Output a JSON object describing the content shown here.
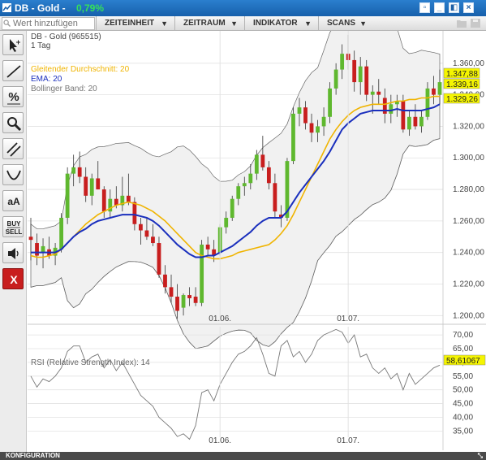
{
  "window": {
    "title": "DB - Gold -",
    "change": "0,79%",
    "change_color": "#35e05a"
  },
  "toolbar": {
    "search_placeholder": "Wert hinzufügen",
    "menus": [
      {
        "label": "ZEITEINHEIT"
      },
      {
        "label": "ZEITRAUM"
      },
      {
        "label": "INDIKATOR"
      },
      {
        "label": "SCANS"
      }
    ]
  },
  "sidebar": {
    "tools": [
      {
        "name": "pointer-tool",
        "icon": "cursor-icon"
      },
      {
        "name": "line-tool",
        "icon": "line-icon"
      },
      {
        "name": "percent-tool",
        "icon": "percent-icon"
      },
      {
        "name": "zoom-tool",
        "icon": "magnifier-icon"
      },
      {
        "name": "channel-tool",
        "icon": "parallel-lines-icon"
      },
      {
        "name": "arc-tool",
        "icon": "arc-icon"
      },
      {
        "name": "text-tool",
        "icon": "text-icon",
        "label": "aA"
      },
      {
        "name": "buy-sell-tool",
        "icon": "buy-sell-icon",
        "label_top": "BUY",
        "label_bottom": "SELL"
      },
      {
        "name": "sound-tool",
        "icon": "speaker-icon"
      },
      {
        "name": "delete-tool",
        "icon": "delete-icon",
        "label": "X"
      }
    ]
  },
  "chart": {
    "instrument": "DB - Gold (965515)",
    "period": "1 Tag",
    "indicators": [
      {
        "label": "Gleitender Durchschnitt: 20",
        "color": "#f0b400"
      },
      {
        "label": "EMA: 20",
        "color": "#1a2fbd"
      },
      {
        "label": "Bollinger Band: 20",
        "color": "#777777"
      }
    ],
    "rsi_label": "RSI (Relative Strength Index): 14",
    "price_labels": [
      {
        "label": "1.347,88",
        "value": 1347.88
      },
      {
        "label": "1.339,16",
        "value": 1339.16
      },
      {
        "label": "1.329,26",
        "value": 1329.26
      }
    ],
    "rsi_value_label": "58,61067",
    "colors": {
      "up": "#5fb82f",
      "down": "#c81e1e",
      "band": "#f1f1f1",
      "sma": "#f0b400",
      "ema": "#1a2fbd",
      "highlight": "#f5f500"
    }
  },
  "chart_data": [
    {
      "type": "candlestick",
      "title": "DB - Gold (965515)",
      "ylim": [
        1195,
        1380
      ],
      "y_ticks": [
        "1.200,00",
        "1.220,00",
        "1.240,00",
        "1.260,00",
        "1.280,00",
        "1.300,00",
        "1.320,00",
        "1.340,00",
        "1.360,00"
      ],
      "y_tick_values": [
        1200,
        1220,
        1240,
        1260,
        1280,
        1300,
        1320,
        1340,
        1360
      ],
      "x_labels": [
        {
          "label": "01.06.",
          "index": 31
        },
        {
          "label": "01.07.",
          "index": 52
        }
      ],
      "candles": [
        [
          1250,
          1262,
          1235,
          1248
        ],
        [
          1246,
          1252,
          1232,
          1238
        ],
        [
          1240,
          1249,
          1230,
          1244
        ],
        [
          1242,
          1250,
          1236,
          1238
        ],
        [
          1238,
          1246,
          1232,
          1243
        ],
        [
          1242,
          1265,
          1240,
          1262
        ],
        [
          1262,
          1294,
          1258,
          1290
        ],
        [
          1290,
          1302,
          1282,
          1294
        ],
        [
          1294,
          1304,
          1284,
          1288
        ],
        [
          1288,
          1294,
          1272,
          1276
        ],
        [
          1276,
          1290,
          1270,
          1287
        ],
        [
          1287,
          1298,
          1280,
          1280
        ],
        [
          1280,
          1282,
          1262,
          1266
        ],
        [
          1266,
          1280,
          1262,
          1274
        ],
        [
          1274,
          1282,
          1268,
          1270
        ],
        [
          1270,
          1288,
          1266,
          1276
        ],
        [
          1276,
          1290,
          1270,
          1272
        ],
        [
          1272,
          1275,
          1254,
          1258
        ],
        [
          1258,
          1262,
          1245,
          1254
        ],
        [
          1254,
          1262,
          1248,
          1250
        ],
        [
          1250,
          1258,
          1244,
          1246
        ],
        [
          1246,
          1250,
          1224,
          1226
        ],
        [
          1226,
          1232,
          1214,
          1218
        ],
        [
          1218,
          1226,
          1208,
          1212
        ],
        [
          1212,
          1220,
          1198,
          1203
        ],
        [
          1205,
          1214,
          1200,
          1213
        ],
        [
          1213,
          1218,
          1206,
          1211
        ],
        [
          1212,
          1218,
          1206,
          1208
        ],
        [
          1208,
          1248,
          1206,
          1245
        ],
        [
          1245,
          1250,
          1238,
          1242
        ],
        [
          1242,
          1248,
          1234,
          1238
        ],
        [
          1240,
          1258,
          1238,
          1256
        ],
        [
          1256,
          1266,
          1252,
          1262
        ],
        [
          1262,
          1276,
          1260,
          1274
        ],
        [
          1274,
          1284,
          1270,
          1282
        ],
        [
          1282,
          1288,
          1276,
          1284
        ],
        [
          1284,
          1296,
          1280,
          1290
        ],
        [
          1290,
          1305,
          1286,
          1302
        ],
        [
          1302,
          1314,
          1292,
          1294
        ],
        [
          1294,
          1298,
          1280,
          1284
        ],
        [
          1284,
          1290,
          1262,
          1266
        ],
        [
          1264,
          1270,
          1256,
          1262
        ],
        [
          1262,
          1300,
          1260,
          1298
        ],
        [
          1298,
          1332,
          1296,
          1328
        ],
        [
          1328,
          1338,
          1320,
          1332
        ],
        [
          1332,
          1336,
          1318,
          1322
        ],
        [
          1322,
          1328,
          1310,
          1316
        ],
        [
          1316,
          1324,
          1310,
          1320
        ],
        [
          1320,
          1332,
          1314,
          1326
        ],
        [
          1326,
          1348,
          1322,
          1344
        ],
        [
          1344,
          1360,
          1340,
          1356
        ],
        [
          1356,
          1372,
          1350,
          1366
        ],
        [
          1366,
          1378,
          1356,
          1362
        ],
        [
          1362,
          1368,
          1342,
          1348
        ],
        [
          1348,
          1364,
          1340,
          1358
        ],
        [
          1358,
          1362,
          1336,
          1340
        ],
        [
          1340,
          1346,
          1328,
          1342
        ],
        [
          1342,
          1350,
          1334,
          1340
        ],
        [
          1338,
          1344,
          1322,
          1328
        ],
        [
          1328,
          1340,
          1322,
          1334
        ],
        [
          1334,
          1340,
          1326,
          1336
        ],
        [
          1336,
          1340,
          1316,
          1318
        ],
        [
          1318,
          1330,
          1314,
          1326
        ],
        [
          1326,
          1334,
          1318,
          1320
        ],
        [
          1320,
          1330,
          1316,
          1326
        ],
        [
          1326,
          1348,
          1324,
          1344
        ],
        [
          1344,
          1352,
          1334,
          1340
        ],
        [
          1340,
          1356,
          1334,
          1348
        ]
      ],
      "sma": [
        1238,
        1237,
        1237,
        1238,
        1239,
        1242,
        1246,
        1250,
        1254,
        1258,
        1261,
        1264,
        1266,
        1268,
        1270,
        1271,
        1272,
        1271,
        1270,
        1268,
        1266,
        1263,
        1260,
        1256,
        1252,
        1248,
        1244,
        1240,
        1238,
        1237,
        1236,
        1236,
        1237,
        1238,
        1240,
        1241,
        1242,
        1243,
        1244,
        1245,
        1248,
        1252,
        1257,
        1264,
        1272,
        1280,
        1288,
        1296,
        1304,
        1312,
        1318,
        1323,
        1327,
        1330,
        1332,
        1333,
        1334,
        1334,
        1334,
        1335,
        1336,
        1336,
        1337,
        1337,
        1338,
        1338,
        1339,
        1339
      ],
      "ema": [
        1240,
        1240,
        1240,
        1240,
        1240,
        1242,
        1246,
        1250,
        1253,
        1255,
        1258,
        1260,
        1261,
        1262,
        1263,
        1264,
        1264,
        1264,
        1263,
        1262,
        1260,
        1257,
        1253,
        1249,
        1245,
        1242,
        1239,
        1237,
        1237,
        1238,
        1238,
        1240,
        1242,
        1244,
        1247,
        1250,
        1253,
        1257,
        1260,
        1262,
        1262,
        1262,
        1266,
        1272,
        1278,
        1283,
        1288,
        1293,
        1298,
        1304,
        1311,
        1318,
        1322,
        1325,
        1328,
        1329,
        1330,
        1330,
        1330,
        1330,
        1331,
        1330,
        1330,
        1330,
        1330,
        1331,
        1332,
        1334
      ]
    },
    {
      "type": "line",
      "title": "RSI (Relative Strength Index): 14",
      "ylim": [
        28,
        73
      ],
      "y_ticks": [
        "35,00",
        "40,00",
        "45,00",
        "50,00",
        "55,00",
        "60,00",
        "65,00",
        "70,00"
      ],
      "y_tick_values": [
        35,
        40,
        45,
        50,
        55,
        60,
        65,
        70
      ],
      "x_labels": [
        {
          "label": "01.06.",
          "index": 31
        },
        {
          "label": "01.07.",
          "index": 52
        }
      ],
      "values": [
        55,
        51,
        54,
        53,
        55,
        58,
        64,
        66,
        66,
        60,
        62,
        63,
        58,
        61,
        57,
        60,
        56,
        52,
        48,
        46,
        44,
        40,
        38,
        36,
        33,
        34,
        32,
        37,
        49,
        50,
        46,
        52,
        56,
        60,
        63,
        64,
        66,
        69,
        63,
        56,
        55,
        66,
        68,
        62,
        64,
        60,
        63,
        68,
        70,
        71,
        72,
        71,
        67,
        70,
        62,
        63,
        58,
        56,
        58,
        54,
        56,
        50,
        56,
        52,
        54,
        56,
        58,
        59
      ]
    }
  ],
  "statusbar": {
    "label": "KONFIGURATION"
  }
}
